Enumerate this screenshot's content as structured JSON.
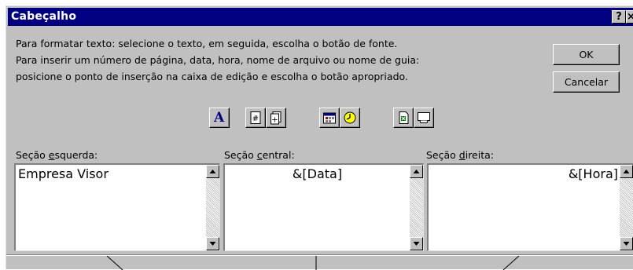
{
  "dialog": {
    "title": "Cabeçalho",
    "help_button": "?",
    "close_button": "×"
  },
  "instructions": [
    "Para formatar texto:  selecione o texto, em seguida, escolha o botão de fonte.",
    "Para inserir um número de página, data, hora, nome de arquivo ou nome de guia:",
    "posicione o ponto de inserção na caixa de edição e escolha o botão apropriado."
  ],
  "buttons": {
    "ok": "OK",
    "cancel": "Cancelar"
  },
  "toolbar": {
    "icons": [
      "font-icon",
      "page-number-icon",
      "total-pages-icon",
      "date-icon",
      "time-icon",
      "file-name-icon",
      "sheet-name-icon"
    ],
    "font_glyph": "A",
    "page_glyph": "#",
    "pages_glyph": "+"
  },
  "sections": {
    "left": {
      "label_pre": "Seção ",
      "label_key": "e",
      "label_post": "squerda:",
      "text": "Empresa Visor"
    },
    "center": {
      "label_pre": "Seção ",
      "label_key": "c",
      "label_post": "entral:",
      "text": "&[Data]"
    },
    "right": {
      "label_pre": "Seção ",
      "label_key": "d",
      "label_post": "ireita:",
      "text": "&[Hora]"
    }
  },
  "colors": {
    "titlebar": "#000080",
    "face": "#c0c0c0"
  }
}
